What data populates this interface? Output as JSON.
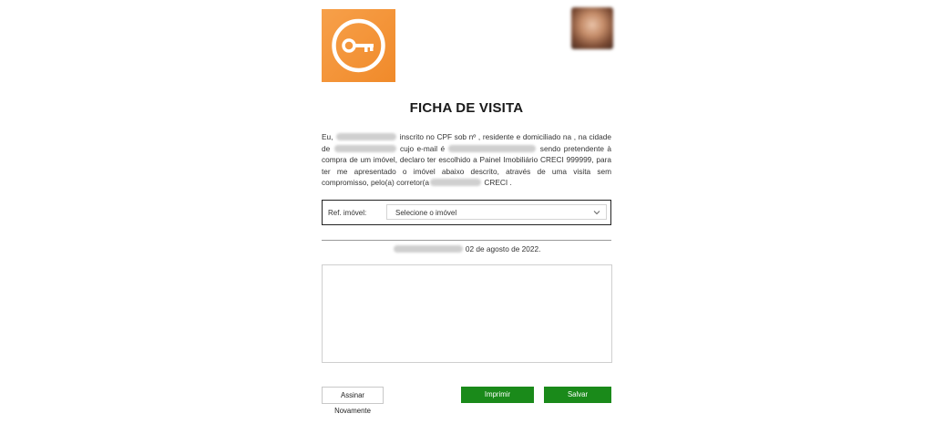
{
  "header": {
    "logo_icon": "key-icon",
    "logo_color": "#f28c28",
    "avatar_icon": "user-photo"
  },
  "title": "FICHA DE VISITA",
  "declaration": {
    "p1": "Eu,",
    "p2": "inscrito no CPF sob nº , residente e domiciliado na , na cidade de",
    "p3": "cujo e-mail é",
    "p4": "sendo pretendente à compra de um imóvel, declaro ter escolhido a Painel Imobiliário CRECI 999999, para ter me apresentado o imóvel abaixo descrito, através de uma visita sem compromisso, pelo(a) corretor(a",
    "p5": "CRECI ."
  },
  "property": {
    "label": "Ref. imóvel:",
    "placeholder": "Selecione o imóvel"
  },
  "date_text": "02 de agosto de 2022.",
  "buttons": {
    "sign_again": "Assinar Novamente",
    "print": "Imprimir",
    "save": "Salvar"
  },
  "colors": {
    "primary_green": "#1a8a1a",
    "accent_orange": "#f28c28"
  }
}
